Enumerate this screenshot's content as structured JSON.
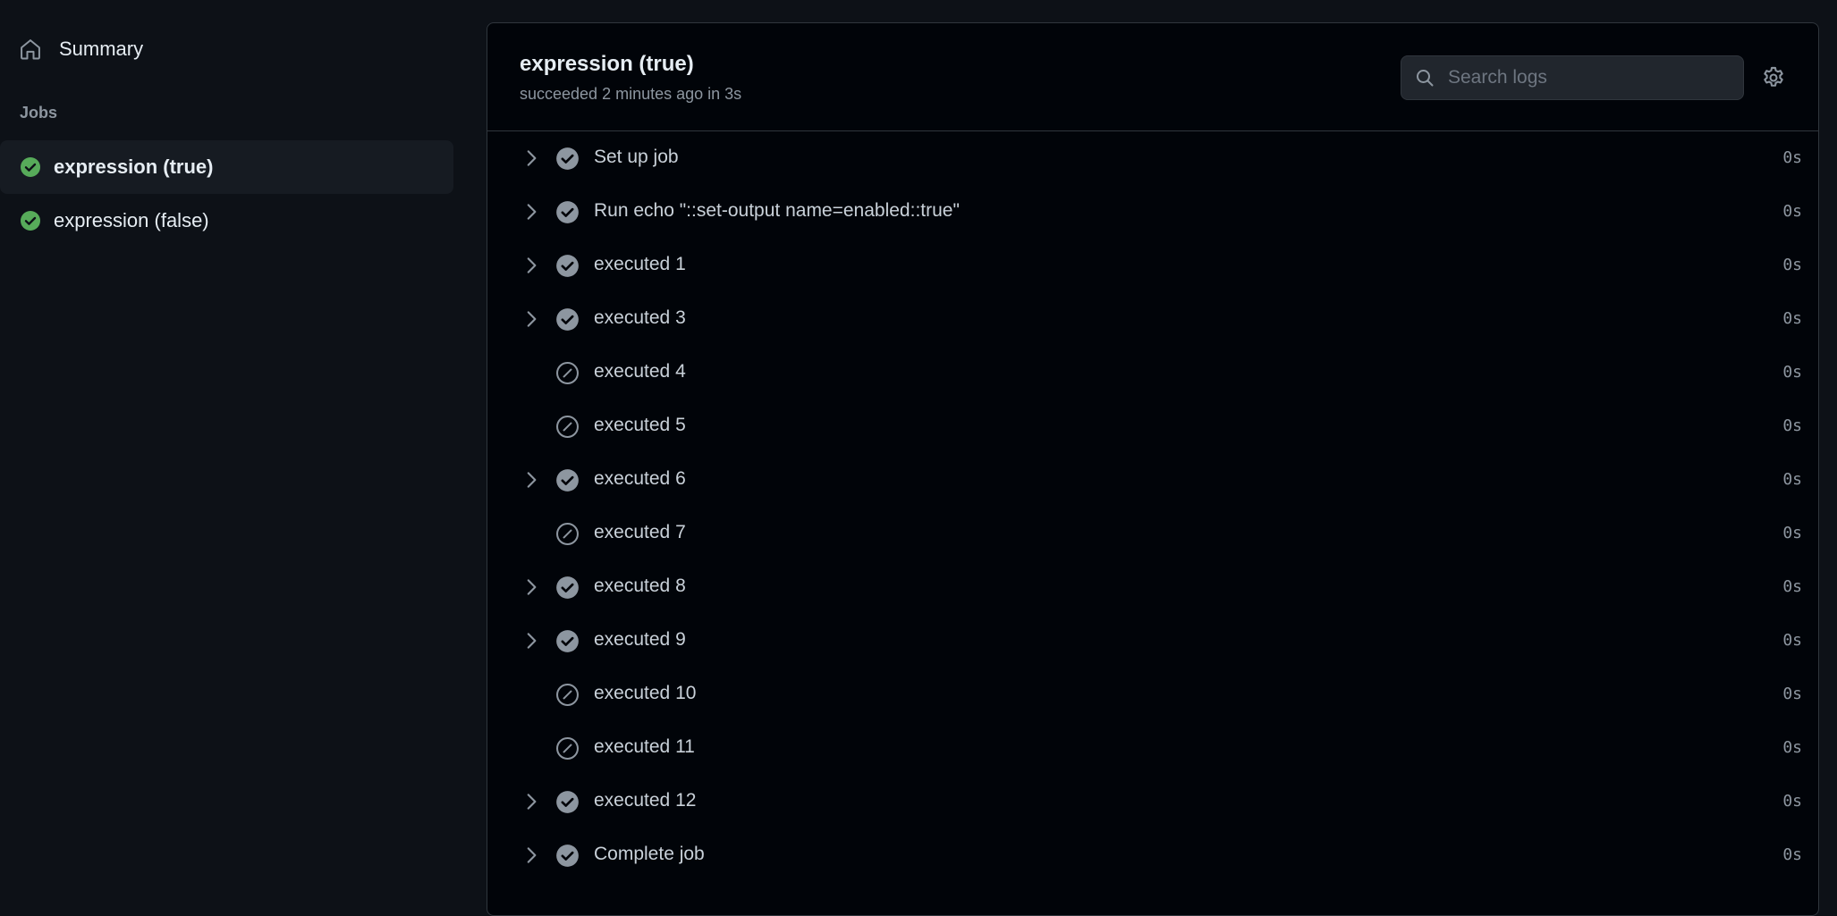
{
  "sidebar": {
    "summary_label": "Summary",
    "jobs_heading": "Jobs",
    "jobs": [
      {
        "label": "expression (true)",
        "status": "success",
        "active": true
      },
      {
        "label": "expression (false)",
        "status": "success",
        "active": false
      }
    ]
  },
  "job": {
    "title": "expression (true)",
    "meta": "succeeded 2 minutes ago in 3s"
  },
  "search": {
    "placeholder": "Search logs",
    "icon": "search-icon"
  },
  "settings_icon": "gear-icon",
  "steps": [
    {
      "name": "Set up job",
      "status": "success",
      "duration": "0s"
    },
    {
      "name": "Run echo \"::set-output name=enabled::true\"",
      "status": "success",
      "duration": "0s"
    },
    {
      "name": "executed 1",
      "status": "success",
      "duration": "0s"
    },
    {
      "name": "executed 3",
      "status": "success",
      "duration": "0s"
    },
    {
      "name": "executed 4",
      "status": "skipped",
      "duration": "0s"
    },
    {
      "name": "executed 5",
      "status": "skipped",
      "duration": "0s"
    },
    {
      "name": "executed 6",
      "status": "success",
      "duration": "0s"
    },
    {
      "name": "executed 7",
      "status": "skipped",
      "duration": "0s"
    },
    {
      "name": "executed 8",
      "status": "success",
      "duration": "0s"
    },
    {
      "name": "executed 9",
      "status": "success",
      "duration": "0s"
    },
    {
      "name": "executed 10",
      "status": "skipped",
      "duration": "0s"
    },
    {
      "name": "executed 11",
      "status": "skipped",
      "duration": "0s"
    },
    {
      "name": "executed 12",
      "status": "success",
      "duration": "0s"
    },
    {
      "name": "Complete job",
      "status": "success",
      "duration": "0s"
    }
  ],
  "colors": {
    "success_green": "#57ab5a",
    "step_check_gray": "#8d96a0",
    "background": "#0d1117",
    "panel": "#010409"
  }
}
